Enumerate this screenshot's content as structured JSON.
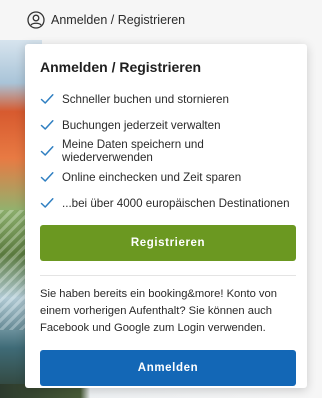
{
  "header": {
    "trigger_label": "Anmelden / Registrieren",
    "trigger_icon": "user-circle-icon"
  },
  "panel": {
    "title": "Anmelden / Registrieren",
    "benefits": [
      "Schneller buchen und stornieren",
      "Buchungen jederzeit verwalten",
      "Meine Daten speichern und wiederverwenden",
      "Online einchecken und Zeit sparen",
      "...bei über 4000 europäischen Destinationen"
    ],
    "register_button": "Registrieren",
    "note": "Sie haben bereits ein booking&more! Konto von einem vorherigen Aufenthalt? Sie können auch Facebook und Google zum Login verwenden.",
    "login_button": "Anmelden"
  },
  "colors": {
    "check": "#2f7fc1",
    "register_button": "#6b9821",
    "login_button": "#1367b6"
  }
}
